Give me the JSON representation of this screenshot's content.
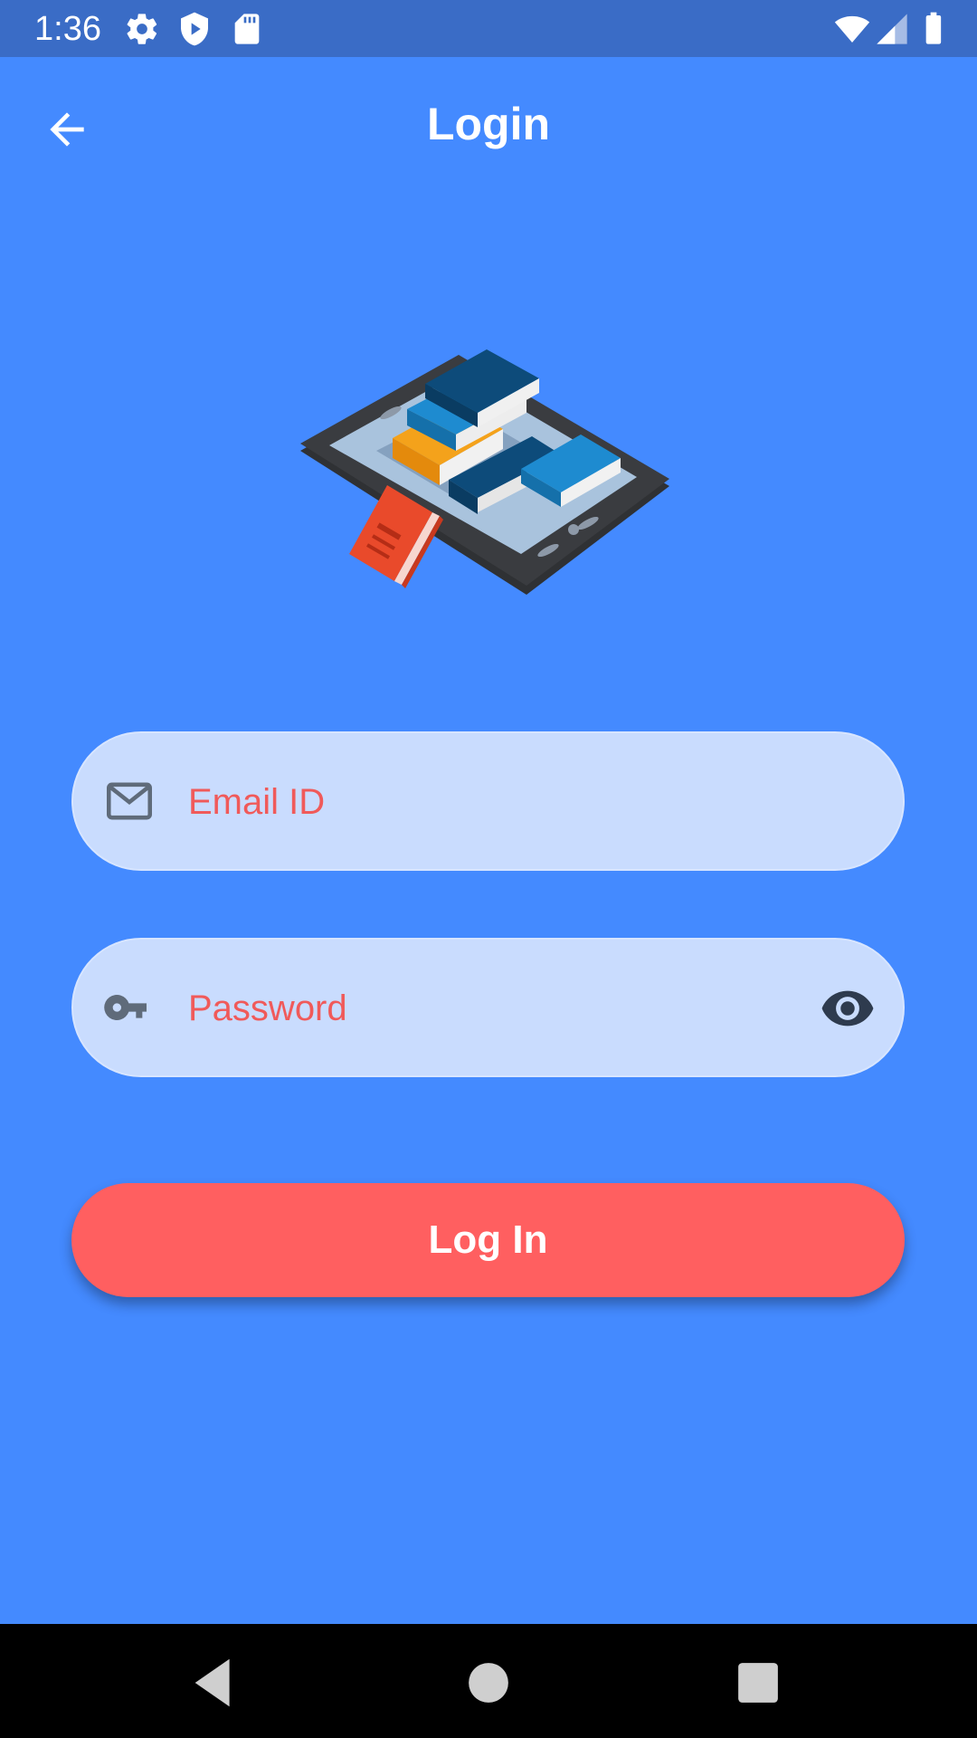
{
  "status_bar": {
    "time": "1:36",
    "left_icons": [
      "gear-icon",
      "shield-play-icon",
      "sd-card-icon"
    ],
    "right_icons": [
      "wifi-icon",
      "signal-icon",
      "battery-icon"
    ]
  },
  "app_bar": {
    "title": "Login",
    "back_icon": "arrow-left-icon"
  },
  "illustration": {
    "name": "books-on-tablet-illustration"
  },
  "form": {
    "email": {
      "placeholder": "Email ID",
      "value": "",
      "icon": "mail-icon"
    },
    "password": {
      "placeholder": "Password",
      "value": "",
      "icon": "key-icon",
      "toggle_icon": "eye-icon"
    },
    "login_label": "Log In"
  },
  "nav_bar": {
    "icons": [
      "back-triangle-icon",
      "home-circle-icon",
      "recents-square-icon"
    ]
  },
  "colors": {
    "background": "#448AFF",
    "status_bar": "#3A6CC6",
    "field_fill": "#C9DCFE",
    "placeholder": "#F05A5A",
    "button": "#FF5F60",
    "icon_gray": "#5F6B7A"
  }
}
